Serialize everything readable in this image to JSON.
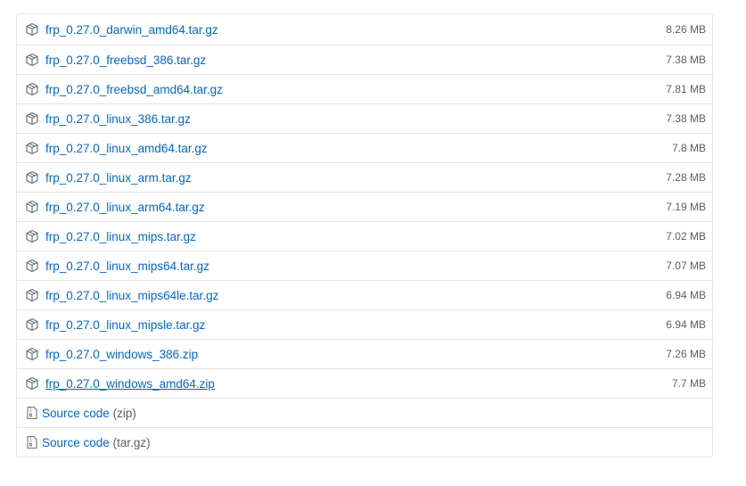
{
  "assets": [
    {
      "name": "frp_0.27.0_darwin_amd64.tar.gz",
      "size": "8.26 MB",
      "icon": "package-icon"
    },
    {
      "name": "frp_0.27.0_freebsd_386.tar.gz",
      "size": "7.38 MB",
      "icon": "package-icon"
    },
    {
      "name": "frp_0.27.0_freebsd_amd64.tar.gz",
      "size": "7.81 MB",
      "icon": "package-icon"
    },
    {
      "name": "frp_0.27.0_linux_386.tar.gz",
      "size": "7.38 MB",
      "icon": "package-icon"
    },
    {
      "name": "frp_0.27.0_linux_amd64.tar.gz",
      "size": "7.8 MB",
      "icon": "package-icon"
    },
    {
      "name": "frp_0.27.0_linux_arm.tar.gz",
      "size": "7.28 MB",
      "icon": "package-icon"
    },
    {
      "name": "frp_0.27.0_linux_arm64.tar.gz",
      "size": "7.19 MB",
      "icon": "package-icon"
    },
    {
      "name": "frp_0.27.0_linux_mips.tar.gz",
      "size": "7.02 MB",
      "icon": "package-icon"
    },
    {
      "name": "frp_0.27.0_linux_mips64.tar.gz",
      "size": "7.07 MB",
      "icon": "package-icon"
    },
    {
      "name": "frp_0.27.0_linux_mips64le.tar.gz",
      "size": "6.94 MB",
      "icon": "package-icon"
    },
    {
      "name": "frp_0.27.0_linux_mipsle.tar.gz",
      "size": "6.94 MB",
      "icon": "package-icon"
    },
    {
      "name": "frp_0.27.0_windows_386.zip",
      "size": "7.26 MB",
      "icon": "package-icon"
    },
    {
      "name": "frp_0.27.0_windows_amd64.zip",
      "size": "7.7 MB",
      "icon": "package-icon",
      "hovered": true
    }
  ],
  "source": [
    {
      "label": "Source code",
      "suffix": "(zip)",
      "icon": "file-zip-icon"
    },
    {
      "label": "Source code",
      "suffix": "(tar.gz)",
      "icon": "file-zip-icon"
    }
  ],
  "colors": {
    "link": "#0366d6",
    "muted": "#586069",
    "border": "#e1e4e8"
  }
}
